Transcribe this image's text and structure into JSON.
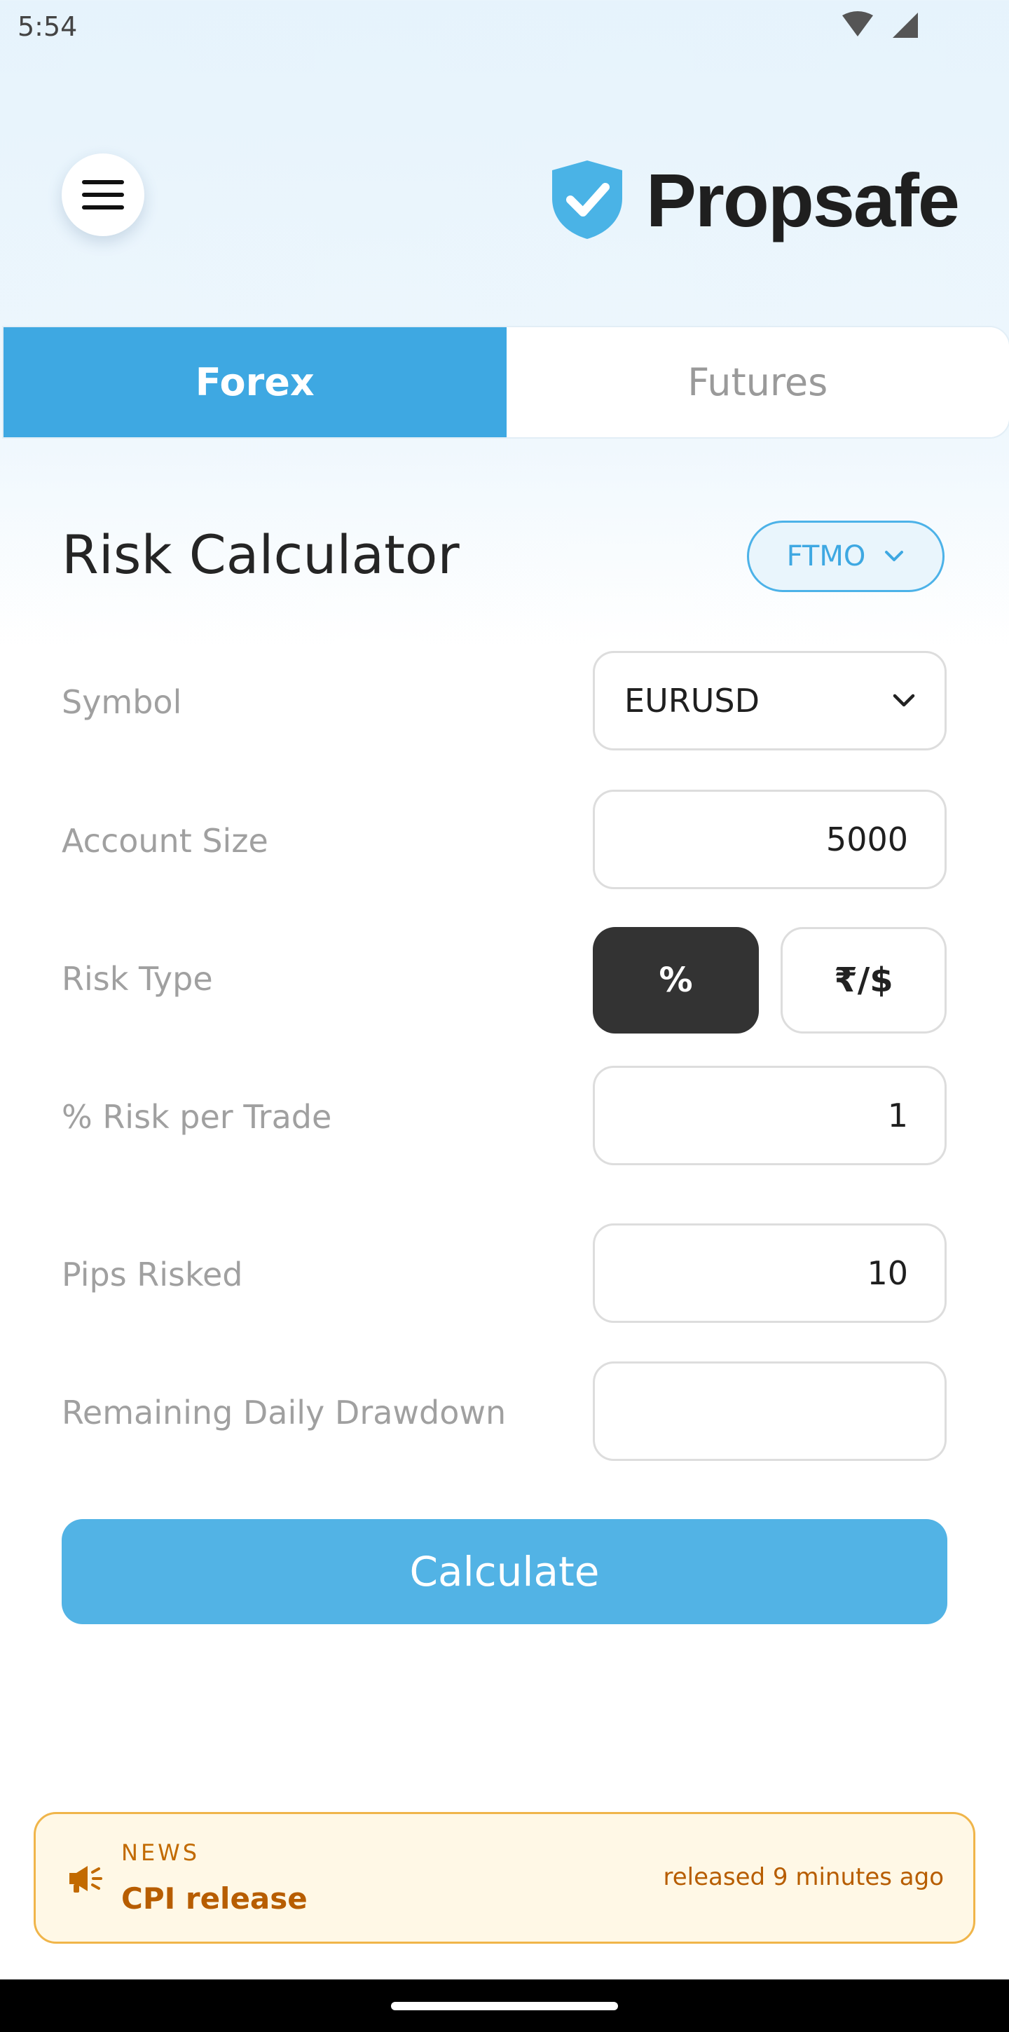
{
  "status_bar": {
    "time": "5:54",
    "icons": [
      "wifi-icon",
      "signal-icon"
    ]
  },
  "header": {
    "menu_icon": "hamburger-menu-icon",
    "logo_icon": "shield-check-icon",
    "brand_name": "Propsafe",
    "brand_color": "#4ab3e6"
  },
  "tabs": [
    {
      "label": "Forex",
      "active": true
    },
    {
      "label": "Futures",
      "active": false
    }
  ],
  "calculator": {
    "title": "Risk Calculator",
    "firm": {
      "selected": "FTMO"
    },
    "fields": {
      "symbol": {
        "label": "Symbol",
        "value": "EURUSD"
      },
      "account_size": {
        "label": "Account Size",
        "value": "5000"
      },
      "risk_type": {
        "label": "Risk Type",
        "options": [
          {
            "label": "%",
            "selected": true
          },
          {
            "label": "₹/$",
            "selected": false
          }
        ]
      },
      "risk_per_trade": {
        "label": "% Risk per Trade",
        "value": "1"
      },
      "pips_risked": {
        "label": "Pips Risked",
        "value": "10"
      },
      "remaining_daily_drawdown": {
        "label": "Remaining Daily Drawdown",
        "value": ""
      }
    },
    "calculate_label": "Calculate"
  },
  "news": {
    "icon": "megaphone-icon",
    "tag": "NEWS",
    "title": "CPI release",
    "time": "released 9 minutes ago"
  },
  "colors": {
    "accent": "#3ea8e2",
    "button": "#52b3e5",
    "toggle_active": "#333333",
    "news_border": "#f0b54a",
    "news_text": "#b75d00"
  }
}
